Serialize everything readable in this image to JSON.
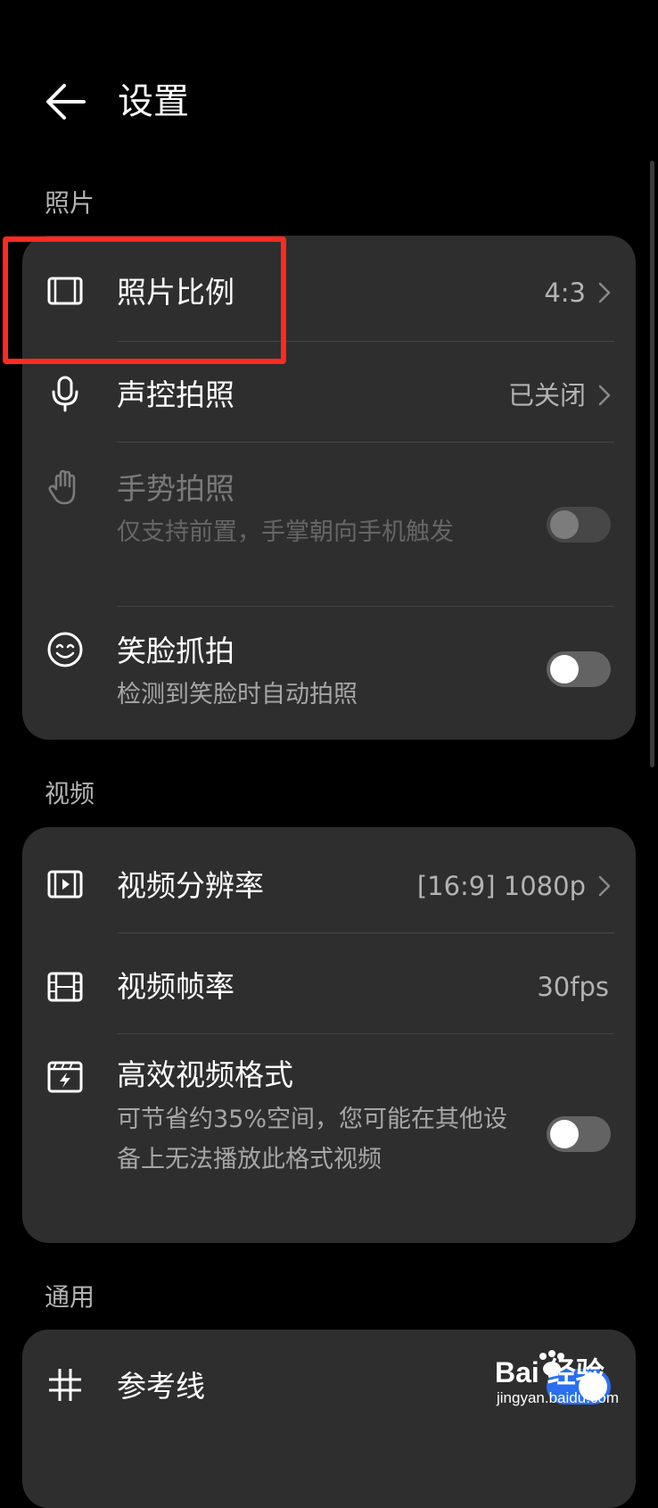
{
  "header": {
    "title": "设置",
    "back_icon": "arrow-left-icon"
  },
  "sections": {
    "photo": {
      "label": "照片",
      "items": [
        {
          "title": "照片比例",
          "value": "4:3",
          "icon": "aspect-ratio-icon"
        },
        {
          "title": "声控拍照",
          "value": "已关闭",
          "icon": "microphone-icon"
        },
        {
          "title": "手势拍照",
          "subtitle": "仅支持前置，手掌朝向手机触发",
          "toggle": "off",
          "disabled": true,
          "icon": "hand-icon"
        },
        {
          "title": "笑脸抓拍",
          "subtitle": "检测到笑脸时自动拍照",
          "toggle": "off",
          "icon": "smile-icon"
        }
      ]
    },
    "video": {
      "label": "视频",
      "items": [
        {
          "title": "视频分辨率",
          "value": "[16:9] 1080p",
          "icon": "video-resolution-icon"
        },
        {
          "title": "视频帧率",
          "value": "30fps",
          "icon": "film-strip-icon"
        },
        {
          "title": "高效视频格式",
          "subtitle": "可节省约35%空间，您可能在其他设备上无法播放此格式视频",
          "toggle": "off",
          "icon": "efficient-video-icon"
        }
      ]
    },
    "general": {
      "label": "通用",
      "items": [
        {
          "title": "参考线",
          "toggle": "on",
          "icon": "grid-hash-icon"
        }
      ]
    }
  },
  "watermark": {
    "brand": "Bai 经验",
    "site": "jingyan.baidu.com"
  },
  "colors": {
    "background": "#000000",
    "card": "#2e2e2e",
    "accent_toggle_on": "#2a6ff0",
    "highlight_box": "#ff2b22"
  }
}
